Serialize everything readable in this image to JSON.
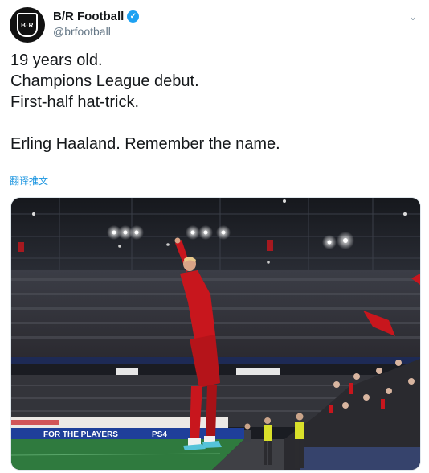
{
  "author": {
    "display_name": "B/R Football",
    "handle": "@brfootball",
    "avatar_text": "B·R",
    "verified": true
  },
  "tweet": {
    "lines": [
      "19 years old.",
      "Champions League debut.",
      "First-half hat-trick."
    ],
    "closing_line": "Erling Haaland. Remember the name.",
    "translate_label": "翻译推文"
  },
  "media": {
    "board_text": "FOR THE PLAYERS",
    "board_brand": "PS4",
    "colors": {
      "kit_red": "#c8161d",
      "pitch": "#2f7a3e",
      "board_blue": "#1f3f9a"
    }
  },
  "icons": {
    "verified": "verified-badge-icon",
    "more": "chevron-down-icon"
  }
}
